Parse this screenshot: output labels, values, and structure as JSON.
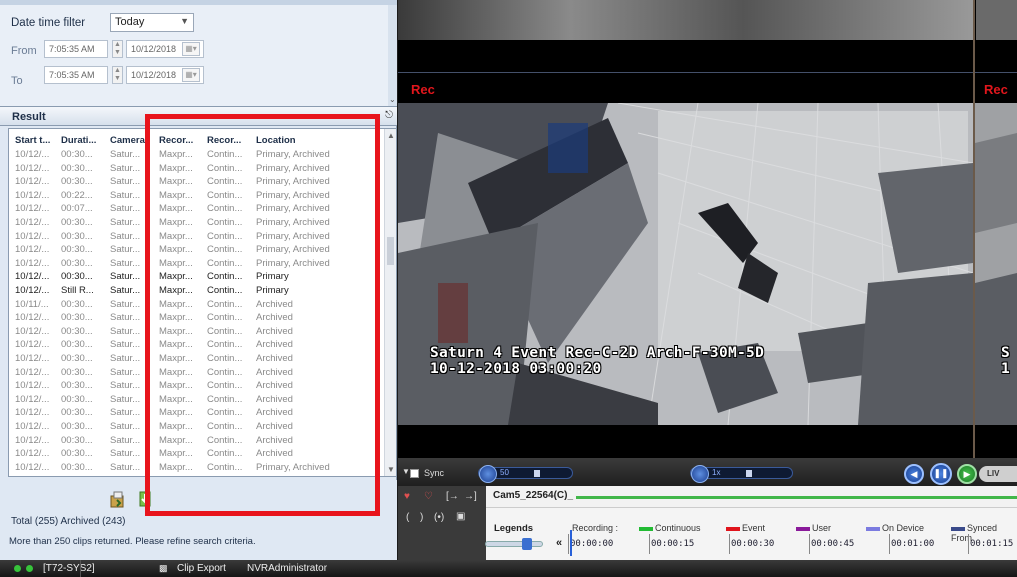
{
  "filter": {
    "date_time_filter_label": "Date time filter",
    "date_time_filter_value": "Today",
    "from_label": "From",
    "to_label": "To",
    "from_time": "7:05:35 AM",
    "from_date": "10/12/2018",
    "to_time": "7:05:35 AM",
    "to_date": "10/12/2018"
  },
  "result": {
    "title": "Result",
    "columns": [
      "Start t...",
      "Durati...",
      "Camera",
      "Recor...",
      "Recor...",
      "Location"
    ],
    "rows": [
      {
        "start": "10/12/...",
        "duration": "00:30...",
        "camera": "Satur...",
        "rec1": "Maxpr...",
        "rec2": "Contin...",
        "location": "Primary, Archived",
        "style": "gray"
      },
      {
        "start": "10/12/...",
        "duration": "00:30...",
        "camera": "Satur...",
        "rec1": "Maxpr...",
        "rec2": "Contin...",
        "location": "Primary, Archived",
        "style": "gray"
      },
      {
        "start": "10/12/...",
        "duration": "00:30...",
        "camera": "Satur...",
        "rec1": "Maxpr...",
        "rec2": "Contin...",
        "location": "Primary, Archived",
        "style": "gray"
      },
      {
        "start": "10/12/...",
        "duration": "00:22...",
        "camera": "Satur...",
        "rec1": "Maxpr...",
        "rec2": "Contin...",
        "location": "Primary, Archived",
        "style": "gray"
      },
      {
        "start": "10/12/...",
        "duration": "00:07...",
        "camera": "Satur...",
        "rec1": "Maxpr...",
        "rec2": "Contin...",
        "location": "Primary, Archived",
        "style": "gray"
      },
      {
        "start": "10/12/...",
        "duration": "00:30...",
        "camera": "Satur...",
        "rec1": "Maxpr...",
        "rec2": "Contin...",
        "location": "Primary, Archived",
        "style": "gray"
      },
      {
        "start": "10/12/...",
        "duration": "00:30...",
        "camera": "Satur...",
        "rec1": "Maxpr...",
        "rec2": "Contin...",
        "location": "Primary, Archived",
        "style": "gray"
      },
      {
        "start": "10/12/...",
        "duration": "00:30...",
        "camera": "Satur...",
        "rec1": "Maxpr...",
        "rec2": "Contin...",
        "location": "Primary, Archived",
        "style": "gray"
      },
      {
        "start": "10/12/...",
        "duration": "00:30...",
        "camera": "Satur...",
        "rec1": "Maxpr...",
        "rec2": "Contin...",
        "location": "Primary, Archived",
        "style": "gray"
      },
      {
        "start": "10/12/...",
        "duration": "00:30...",
        "camera": "Satur...",
        "rec1": "Maxpr...",
        "rec2": "Contin...",
        "location": "Primary",
        "style": "dark"
      },
      {
        "start": "10/12/...",
        "duration": "Still R...",
        "camera": "Satur...",
        "rec1": "Maxpr...",
        "rec2": "Contin...",
        "location": "Primary",
        "style": "dark"
      },
      {
        "start": "10/11/...",
        "duration": "00:30...",
        "camera": "Satur...",
        "rec1": "Maxpr...",
        "rec2": "Contin...",
        "location": "Archived",
        "style": "gray"
      },
      {
        "start": "10/12/...",
        "duration": "00:30...",
        "camera": "Satur...",
        "rec1": "Maxpr...",
        "rec2": "Contin...",
        "location": "Archived",
        "style": "gray"
      },
      {
        "start": "10/12/...",
        "duration": "00:30...",
        "camera": "Satur...",
        "rec1": "Maxpr...",
        "rec2": "Contin...",
        "location": "Archived",
        "style": "gray"
      },
      {
        "start": "10/12/...",
        "duration": "00:30...",
        "camera": "Satur...",
        "rec1": "Maxpr...",
        "rec2": "Contin...",
        "location": "Archived",
        "style": "gray"
      },
      {
        "start": "10/12/...",
        "duration": "00:30...",
        "camera": "Satur...",
        "rec1": "Maxpr...",
        "rec2": "Contin...",
        "location": "Archived",
        "style": "gray"
      },
      {
        "start": "10/12/...",
        "duration": "00:30...",
        "camera": "Satur...",
        "rec1": "Maxpr...",
        "rec2": "Contin...",
        "location": "Archived",
        "style": "gray"
      },
      {
        "start": "10/12/...",
        "duration": "00:30...",
        "camera": "Satur...",
        "rec1": "Maxpr...",
        "rec2": "Contin...",
        "location": "Archived",
        "style": "gray"
      },
      {
        "start": "10/12/...",
        "duration": "00:30...",
        "camera": "Satur...",
        "rec1": "Maxpr...",
        "rec2": "Contin...",
        "location": "Archived",
        "style": "gray"
      },
      {
        "start": "10/12/...",
        "duration": "00:30...",
        "camera": "Satur...",
        "rec1": "Maxpr...",
        "rec2": "Contin...",
        "location": "Archived",
        "style": "gray"
      },
      {
        "start": "10/12/...",
        "duration": "00:30...",
        "camera": "Satur...",
        "rec1": "Maxpr...",
        "rec2": "Contin...",
        "location": "Archived",
        "style": "gray"
      },
      {
        "start": "10/12/...",
        "duration": "00:30...",
        "camera": "Satur...",
        "rec1": "Maxpr...",
        "rec2": "Contin...",
        "location": "Archived",
        "style": "gray"
      },
      {
        "start": "10/12/...",
        "duration": "00:30...",
        "camera": "Satur...",
        "rec1": "Maxpr...",
        "rec2": "Contin...",
        "location": "Archived",
        "style": "gray"
      },
      {
        "start": "10/12/...",
        "duration": "00:30...",
        "camera": "Satur...",
        "rec1": "Maxpr...",
        "rec2": "Contin...",
        "location": "Primary, Archived",
        "style": "gray"
      },
      {
        "start": "10/12/...",
        "duration": "00:30...",
        "camera": "Satur...",
        "rec1": "Maxpr...",
        "rec2": "Contin...",
        "location": "Primary, Archived",
        "style": "gray"
      }
    ],
    "total": "Total (255) Archived (243)",
    "more_message": "More than 250 clips returned. Please refine search criteria."
  },
  "video": {
    "rec_label": "Rec",
    "overlay_line1": "Saturn 4 Event Rec-C-2D Arch-F-30M-5D",
    "overlay_line2": "10-12-2018 03:00:20",
    "overlay_right1": "S",
    "overlay_right2": "1"
  },
  "controls": {
    "sync_label": "Sync",
    "speed_value": "50",
    "rate_value": "1x",
    "live_label": "LIV"
  },
  "timeline": {
    "camera_name": "Cam5_22564(C)_",
    "legends_title": "Legends",
    "recording_label": "Recording :",
    "legend_items": [
      {
        "label": "Continuous",
        "color": "#22bb33"
      },
      {
        "label": "Event",
        "color": "#e0141c"
      },
      {
        "label": "User",
        "color": "#8a1a9a"
      },
      {
        "label": "On Device",
        "color": "#7b7be0"
      },
      {
        "label": "Synced From",
        "color": "#3a4a8a"
      }
    ],
    "ticks": [
      "00:00:00",
      "00:00:15",
      "00:00:30",
      "00:00:45",
      "00:01:00",
      "00:01:15"
    ]
  },
  "taskbar": {
    "system_label": "[T72-SYS2]",
    "clip_export": "Clip Export",
    "user": "NVRAdministrator"
  },
  "colors": {
    "highlight_box": "#e8141c",
    "rec_red": "#e0161c",
    "panel_bg": "#dfe8f3"
  }
}
